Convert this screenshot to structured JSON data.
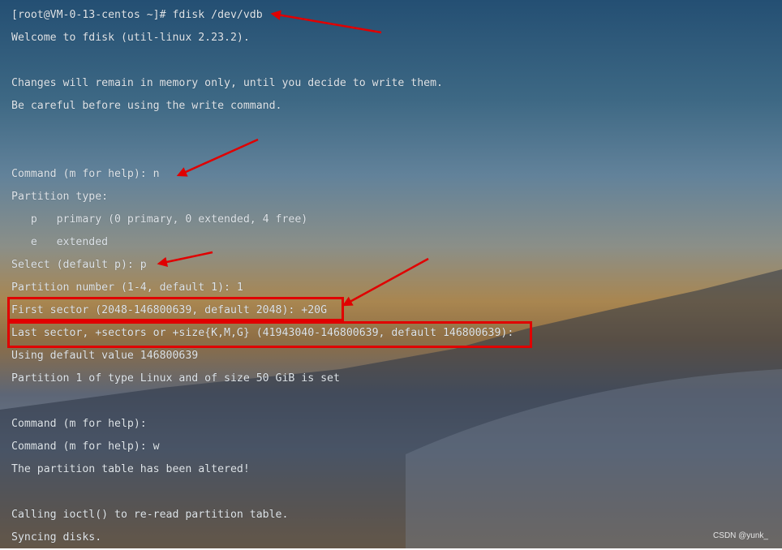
{
  "terminal": {
    "lines": [
      "[root@VM-0-13-centos ~]# fdisk /dev/vdb",
      "Welcome to fdisk (util-linux 2.23.2).",
      "",
      "Changes will remain in memory only, until you decide to write them.",
      "Be careful before using the write command.",
      "",
      "",
      "Command (m for help): n",
      "Partition type:",
      "   p   primary (0 primary, 0 extended, 4 free)",
      "   e   extended",
      "Select (default p): p",
      "Partition number (1-4, default 1): 1",
      "First sector (2048-146800639, default 2048): +20G",
      "Last sector, +sectors or +size{K,M,G} (41943040-146800639, default 146800639):",
      "Using default value 146800639",
      "Partition 1 of type Linux and of size 50 GiB is set",
      "",
      "Command (m for help):",
      "Command (m for help): w",
      "The partition table has been altered!",
      "",
      "Calling ioctl() to re-read partition table.",
      "Syncing disks."
    ],
    "text_color": "#dfe5ea"
  },
  "annotations": {
    "color": "#e00000"
  },
  "watermark": "CSDN @yunk_"
}
